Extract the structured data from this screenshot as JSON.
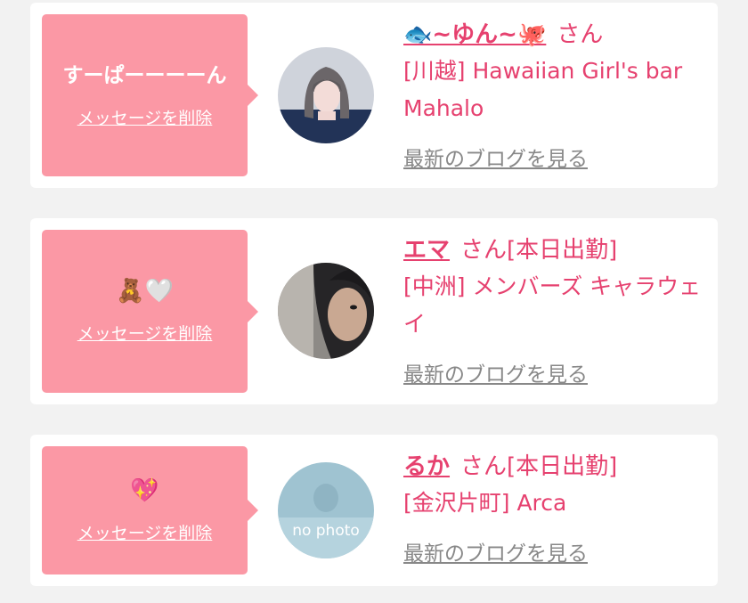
{
  "colors": {
    "accent": "#e6416f",
    "bubble": "#fb98a5",
    "muted": "#888888",
    "background": "#f2f2f2"
  },
  "cards": [
    {
      "bubble_text": "すーぱーーーーん",
      "delete_label": "メッセージを削除",
      "name": "🐟~ゆん~🐙",
      "san": "さん",
      "attendance": "",
      "store": "[川越] Hawaiian Girl's bar Mahalo",
      "blog_label": "最新のブログを見る"
    },
    {
      "bubble_text": "🧸🤍",
      "delete_label": "メッセージを削除",
      "name": "エマ",
      "san": "さん",
      "attendance": "[本日出勤]",
      "store": "[中洲] メンバーズ キャラウェイ",
      "blog_label": "最新のブログを見る"
    },
    {
      "bubble_text": "💖",
      "delete_label": "メッセージを削除",
      "name": "るか",
      "san": "さん",
      "attendance": "[本日出勤]",
      "store": "[金沢片町] Arca",
      "blog_label": "最新のブログを見る",
      "avatar_text": "no photo"
    }
  ]
}
